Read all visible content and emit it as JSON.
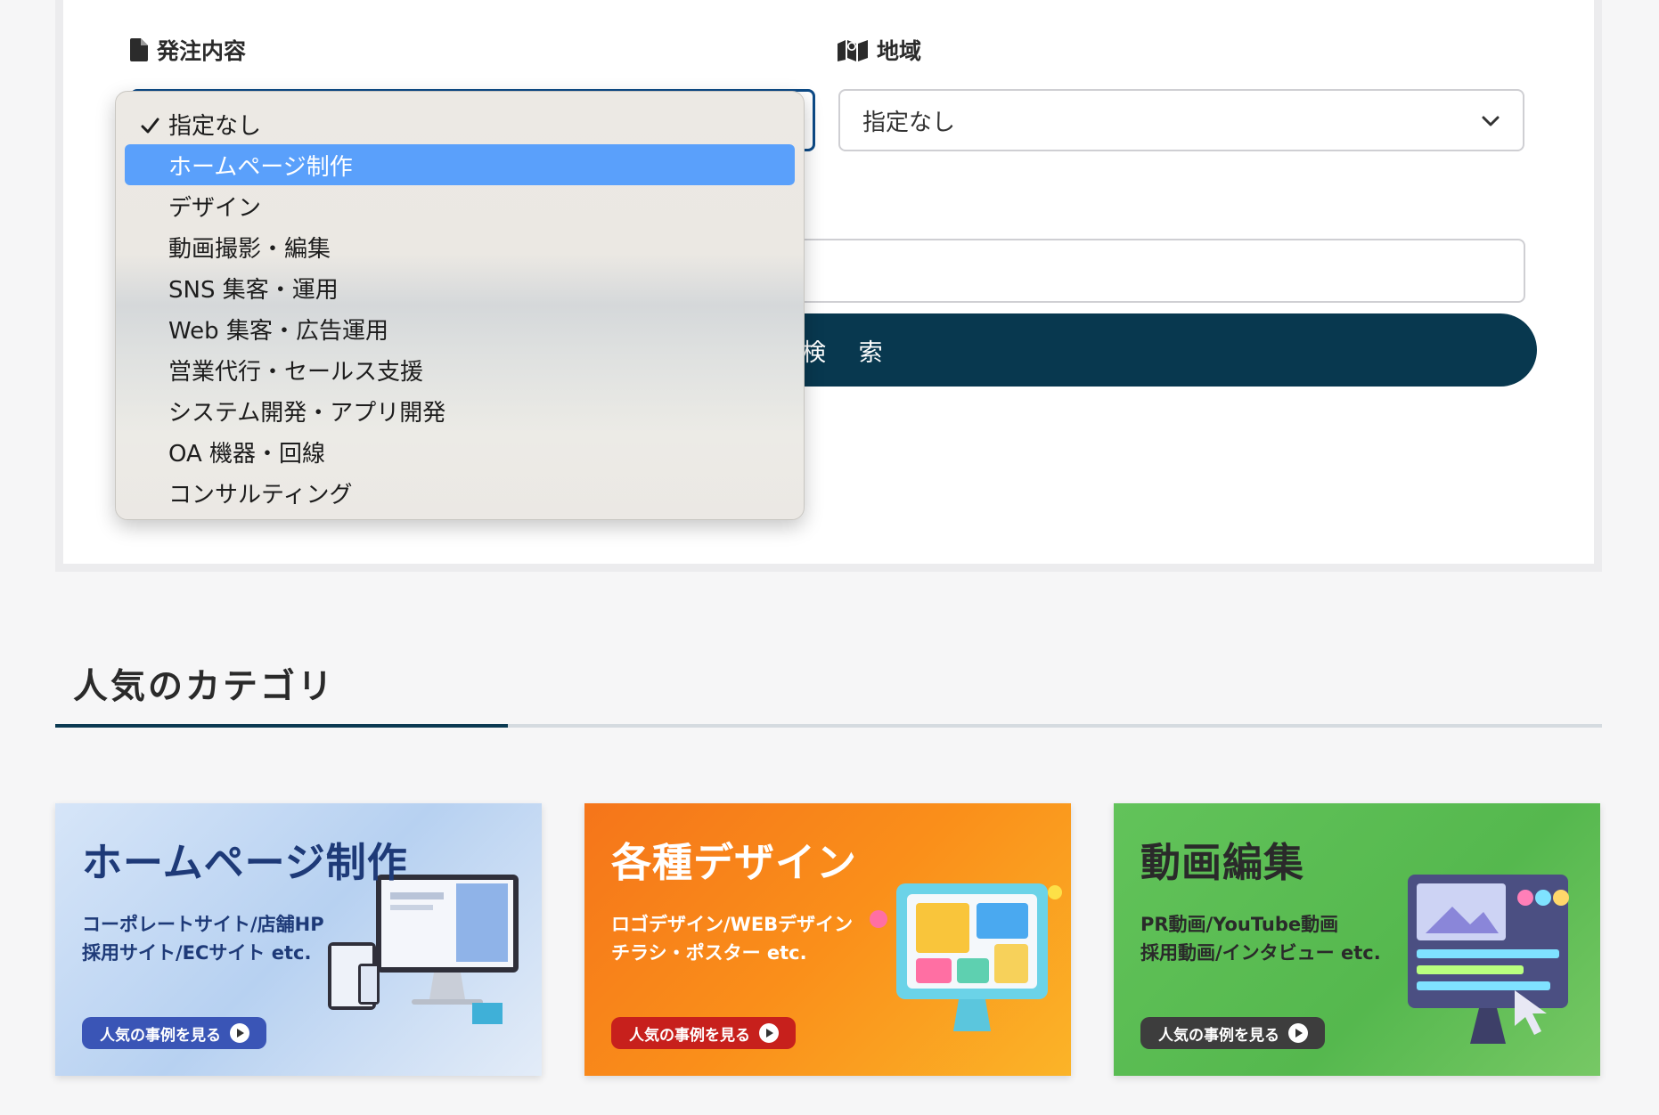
{
  "search": {
    "order_label": "発注内容",
    "order_icon": "document-icon",
    "area_label": "地域",
    "area_icon": "map-icon",
    "area_select_value": "指定なし",
    "search_button_label": "検 索"
  },
  "dropdown": {
    "options": [
      {
        "label": "指定なし",
        "checked": true
      },
      {
        "label": "ホームページ制作",
        "highlighted": true
      },
      {
        "label": "デザイン"
      },
      {
        "label": "動画撮影・編集"
      },
      {
        "label": "SNS 集客・運用"
      },
      {
        "label": "Web 集客・広告運用"
      },
      {
        "label": "営業代行・セールス支援"
      },
      {
        "label": "システム開発・アプリ開発"
      },
      {
        "label": "OA 機器・回線"
      },
      {
        "label": "コンサルティング"
      }
    ],
    "highlight_color": "#5aa0fb"
  },
  "popular": {
    "title": "人気のカテゴリ",
    "accent_color": "#0b3a52",
    "cards": [
      {
        "title": "ホームページ制作",
        "subtitle": "コーポレートサイト/店舗HP\n採用サイト/ECサイト etc.",
        "cta": "人気の事例を見る"
      },
      {
        "title": "各種デザイン",
        "subtitle": "ロゴデザイン/WEBデザイン\nチラシ・ポスター etc.",
        "cta": "人気の事例を見る"
      },
      {
        "title": "動画編集",
        "subtitle": "PR動画/YouTube動画\n採用動画/インタビュー etc.",
        "cta": "人気の事例を見る"
      }
    ]
  },
  "colors": {
    "button_dark": "#08384f",
    "focus_border": "#0d4a86"
  }
}
